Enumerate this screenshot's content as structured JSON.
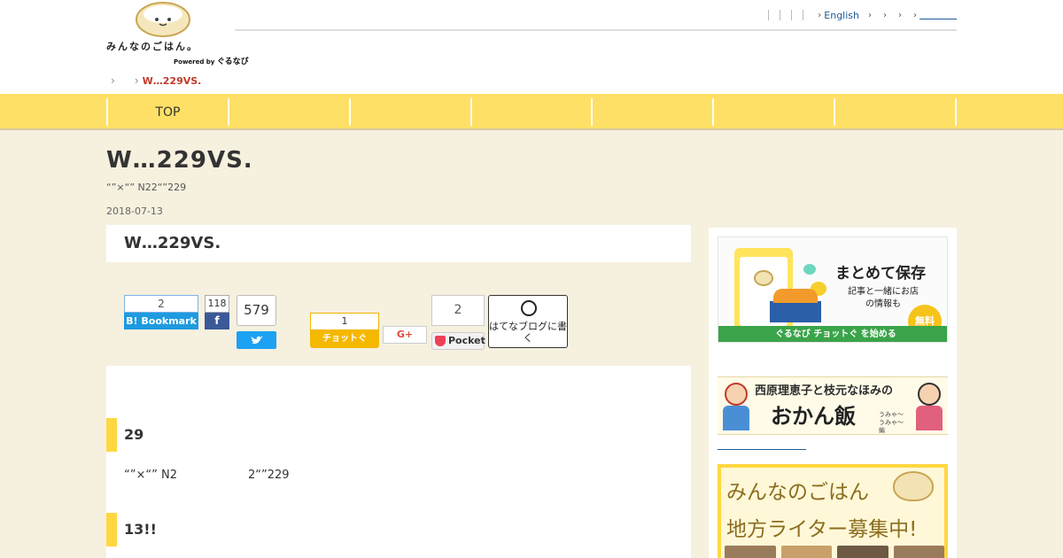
{
  "logo": {
    "wordmark": "みんなのごはん。",
    "powered_prefix": "Powered by",
    "powered_brand": "ぐるなび"
  },
  "topnav": {
    "english": "English",
    "last": ""
  },
  "breadcrumb": {
    "current": "W…229VS."
  },
  "catnav": {
    "items": [
      "TOP",
      "",
      "",
      "",
      "",
      "",
      ""
    ]
  },
  "article": {
    "title": "W…229VS.",
    "subtitle": "“”×“” N22“”229",
    "date": "2018-07-13",
    "box_title": "W…229VS."
  },
  "share": {
    "hatena_count": "2",
    "hatena_label": "B! Bookmark",
    "facebook_count": "118",
    "facebook_label": "f",
    "twitter_count": "579",
    "chotto_count": "1",
    "chotto_label": "チョットぐ",
    "gplus_label": "G+",
    "pocket_count": "2",
    "pocket_label": "Pocket",
    "hatena_blog_label": "はてなブログに書く"
  },
  "content": {
    "h2_first": "29",
    "para_left": "“”×“” N2",
    "para_right": "2“”229",
    "h2_second": "13!!"
  },
  "sidebar": {
    "banner1": {
      "title": "まとめて保存",
      "sub": "記事と一緒にお店の情報も",
      "free": "無料",
      "bar": "ぐるなび チョットぐ を始める"
    },
    "banner2": {
      "top": "西原理恵子と枝元なほみの",
      "big": "おかん飯",
      "small": "うみゃ～うみゃ～編"
    },
    "banner3": {
      "line1": "みんなのごはん",
      "line2": "地方ライター募集中!"
    }
  },
  "colors": {
    "accent_yellow": "#ffe066",
    "page_bg": "#f6f0df",
    "breadcrumb_current": "#c0392b",
    "link_blue": "#1b5a9a"
  }
}
